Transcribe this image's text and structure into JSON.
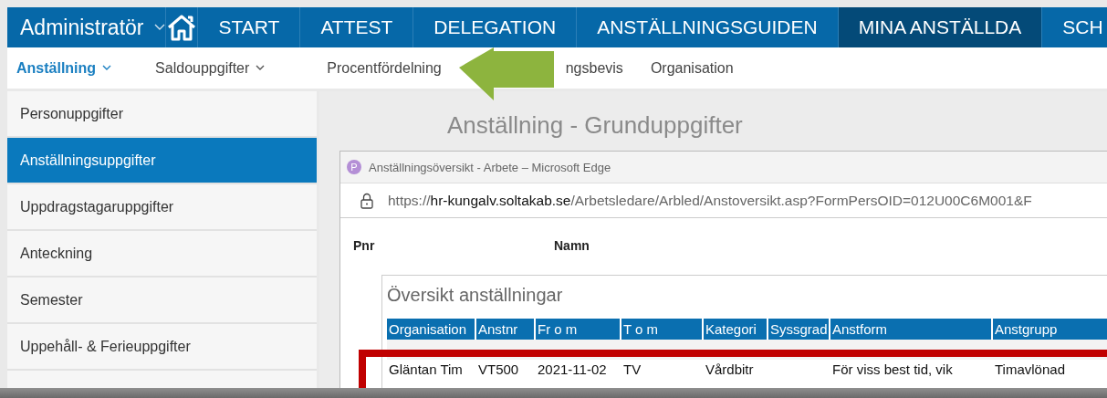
{
  "top_nav": {
    "account": "Administratör",
    "items": [
      {
        "label": "START",
        "selected": false
      },
      {
        "label": "ATTEST",
        "selected": false
      },
      {
        "label": "DELEGATION",
        "selected": false
      },
      {
        "label": "ANSTÄLLNINGSGUIDEN",
        "selected": false
      },
      {
        "label": "MINA ANSTÄLLDA",
        "selected": true
      },
      {
        "label": "SCH",
        "selected": false
      }
    ]
  },
  "sub_nav": [
    {
      "label": "Anställning",
      "selected": true,
      "dropdown": true
    },
    {
      "label": "Saldouppgifter",
      "selected": false,
      "dropdown": true
    },
    {
      "label": "Procentfördelning",
      "selected": false,
      "dropdown": false
    },
    {
      "label": "ngsbevis",
      "selected": false,
      "dropdown": false
    },
    {
      "label": "Organisation",
      "selected": false,
      "dropdown": false
    }
  ],
  "sidebar": {
    "items": [
      {
        "label": "Personuppgifter",
        "selected": false
      },
      {
        "label": "Anställningsuppgifter",
        "selected": true
      },
      {
        "label": "Uppdragstagaruppgifter",
        "selected": false
      },
      {
        "label": "Anteckning",
        "selected": false
      },
      {
        "label": "Semester",
        "selected": false
      },
      {
        "label": "Uppehåll- & Ferieuppgifter",
        "selected": false
      }
    ]
  },
  "page_title": "Anställning - Grunduppgifter",
  "popup": {
    "profile_badge": "P",
    "title": "Anställningsöversikt - Arbete – Microsoft Edge",
    "url": {
      "prefix": "https://",
      "host": "hr-kungalv.soltakab.se",
      "path": "/Arbetsledare/Arbled/Anstoversikt.asp?FormPersOID=012U00C6M001&F"
    },
    "fields": [
      "Pnr",
      "Namn"
    ],
    "fieldset_title": "Översikt anställningar",
    "table": {
      "columns": [
        "Organisation",
        "Anstnr",
        "Fr o m",
        "T o m",
        "Kategori",
        "Syssgrad",
        "Anstform",
        "Anstgrupp"
      ],
      "rows": [
        [
          "Gläntan Tim",
          "VT500",
          "2021-11-02",
          "TV",
          "Vårdbitr",
          "",
          "För viss best tid, vik",
          "Timavlönad"
        ]
      ]
    }
  }
}
